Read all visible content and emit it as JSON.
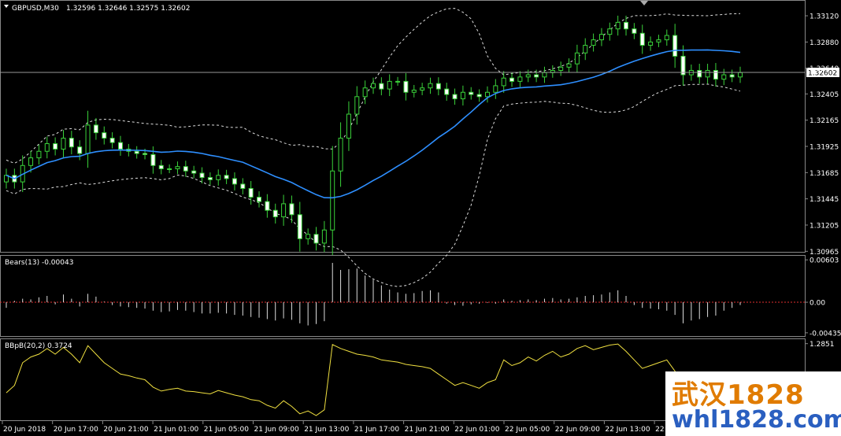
{
  "chart_data": {
    "type": "candlestick",
    "symbol_label": "GBPUSD,M30",
    "ohlc_label": "1.32596 1.32646 1.32575 1.32602",
    "current_price_label": "1.32602",
    "current_price": 1.32602,
    "price_range": [
      1.3096,
      1.3325
    ],
    "price_ticks": [
      "1.33120",
      "1.32880",
      "1.32640",
      "1.32405",
      "1.32165",
      "1.31925",
      "1.31685",
      "1.31445",
      "1.31205",
      "1.30965"
    ],
    "price_tick_values": [
      1.3312,
      1.3288,
      1.3264,
      1.32405,
      1.32165,
      1.31925,
      1.31685,
      1.31445,
      1.31205,
      1.30965
    ],
    "time_labels": [
      "20 Jun 2018",
      "20 Jun 17:00",
      "20 Jun 21:00",
      "21 Jun 01:00",
      "21 Jun 05:00",
      "21 Jun 09:00",
      "21 Jun 13:00",
      "21 Jun 17:00",
      "21 Jun 21:00",
      "22 Jun 01:00",
      "22 Jun 05:00",
      "22 Jun 09:00",
      "22 Jun 13:00",
      "22"
    ],
    "close": [
      1.3166,
      1.316,
      1.3175,
      1.3182,
      1.3188,
      1.3195,
      1.319,
      1.32,
      1.3192,
      1.3186,
      1.3212,
      1.3205,
      1.32,
      1.3196,
      1.319,
      1.3188,
      1.3186,
      1.3185,
      1.3175,
      1.3172,
      1.3172,
      1.3174,
      1.317,
      1.3168,
      1.3164,
      1.3162,
      1.3166,
      1.3163,
      1.3158,
      1.3154,
      1.3146,
      1.3142,
      1.3134,
      1.3128,
      1.314,
      1.313,
      1.3108,
      1.3112,
      1.3104,
      1.3116,
      1.317,
      1.32,
      1.3222,
      1.3238,
      1.3246,
      1.325,
      1.3245,
      1.3252,
      1.3252,
      1.3242,
      1.3244,
      1.3246,
      1.325,
      1.3245,
      1.324,
      1.3236,
      1.3242,
      1.324,
      1.3238,
      1.3242,
      1.3248,
      1.3255,
      1.3252,
      1.3256,
      1.3258,
      1.3256,
      1.326,
      1.3262,
      1.3265,
      1.3268,
      1.3278,
      1.3285,
      1.329,
      1.3295,
      1.33,
      1.3306,
      1.33,
      1.3296,
      1.3285,
      1.3288,
      1.329,
      1.3294,
      1.3275,
      1.3258,
      1.3262,
      1.3256,
      1.3262,
      1.3254,
      1.3258,
      1.3256,
      1.326
    ],
    "bears": {
      "label": "Bears(13) -0.00043",
      "ticks": [
        "0.00603",
        "0.00",
        "-0.00435"
      ],
      "tick_values": [
        0.00603,
        0.0,
        -0.00435
      ],
      "range": [
        -0.0047,
        0.0065
      ],
      "values": [
        -0.0008,
        0.0002,
        0.0005,
        0.0004,
        0.0007,
        0.0009,
        -0.0003,
        0.0011,
        0.0005,
        -0.0006,
        0.0012,
        0.0008,
        0.0001,
        -0.0004,
        -0.0006,
        -0.0007,
        -0.0008,
        -0.0009,
        -0.0012,
        -0.0014,
        -0.0013,
        -0.0011,
        -0.0012,
        -0.0014,
        -0.0016,
        -0.0016,
        -0.0015,
        -0.0016,
        -0.0018,
        -0.0019,
        -0.0021,
        -0.0022,
        -0.0024,
        -0.0026,
        -0.0023,
        -0.0025,
        -0.003,
        -0.0033,
        -0.0031,
        -0.0027,
        0.0056,
        0.0046,
        0.0047,
        0.0048,
        0.0038,
        0.0032,
        0.0024,
        0.0018,
        0.0014,
        0.0012,
        0.0013,
        0.0016,
        0.0017,
        0.0014,
        -0.0002,
        -0.0004,
        -0.0005,
        -0.0003,
        -0.0002,
        -0.0001,
        -0.0002,
        0.0004,
        0.0002,
        0.0003,
        0.0004,
        0.0003,
        0.0005,
        0.0006,
        0.0004,
        0.0005,
        0.0007,
        0.0009,
        0.001,
        0.0011,
        0.0014,
        0.0017,
        0.0009,
        -0.0004,
        -0.0008,
        -0.0009,
        -0.001,
        -0.0012,
        -0.0018,
        -0.003,
        -0.0026,
        -0.0024,
        -0.0021,
        -0.0019,
        -0.0012,
        -0.0008,
        -0.0004
      ]
    },
    "bbpb": {
      "label": "BBpB(20,2) 0.3724",
      "ticks": [
        "1.2851"
      ],
      "tick_values": [
        1.2851
      ],
      "range": [
        -0.05,
        1.35
      ],
      "values": [
        0.42,
        0.55,
        0.95,
        1.05,
        1.1,
        1.2,
        1.1,
        1.22,
        1.1,
        0.95,
        1.25,
        1.1,
        0.95,
        0.85,
        0.75,
        0.72,
        0.68,
        0.65,
        0.52,
        0.45,
        0.48,
        0.5,
        0.45,
        0.44,
        0.42,
        0.4,
        0.46,
        0.42,
        0.38,
        0.35,
        0.3,
        0.28,
        0.2,
        0.15,
        0.28,
        0.18,
        0.05,
        0.1,
        0.02,
        0.12,
        1.27,
        1.2,
        1.15,
        1.1,
        1.08,
        1.05,
        1.0,
        0.98,
        0.96,
        0.92,
        0.9,
        0.88,
        0.85,
        0.75,
        0.65,
        0.55,
        0.6,
        0.55,
        0.5,
        0.6,
        0.65,
        1.0,
        0.9,
        0.95,
        1.05,
        0.98,
        1.08,
        1.15,
        1.05,
        1.1,
        1.2,
        1.25,
        1.18,
        1.22,
        1.26,
        1.28,
        1.15,
        1.0,
        0.85,
        0.9,
        0.95,
        1.0,
        0.8,
        0.55,
        0.62,
        0.58,
        0.6,
        0.55,
        0.5,
        0.45,
        0.37
      ]
    }
  },
  "watermark": {
    "line1": "武汉1828",
    "line2": "whl1828.com"
  }
}
